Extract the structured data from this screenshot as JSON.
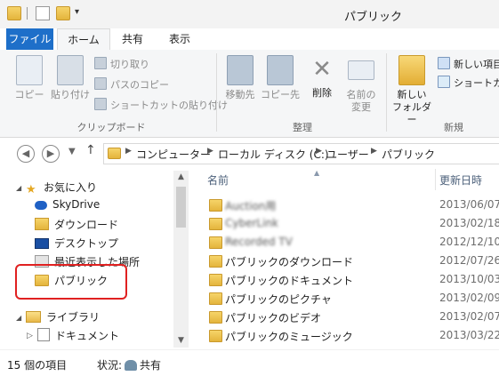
{
  "window": {
    "title": "パブリック"
  },
  "tabs": [
    {
      "label": "ファイル"
    },
    {
      "label": "ホーム"
    },
    {
      "label": "共有"
    },
    {
      "label": "表示"
    }
  ],
  "ribbon": {
    "clipboard": {
      "copy": "コピー",
      "paste": "貼り付け",
      "cut": "切り取り",
      "copy_path": "パスのコピー",
      "paste_shortcut": "ショートカットの貼り付け",
      "group_label": "クリップボード"
    },
    "organize": {
      "move_to": "移動先",
      "copy_to": "コピー先",
      "delete": "削除",
      "rename_line1": "名前の",
      "rename_line2": "変更",
      "group_label": "整理"
    },
    "new": {
      "new_folder_line1": "新しい",
      "new_folder_line2": "フォルダー",
      "new_item": "新しい項目",
      "shortcut": "ショートカット",
      "group_label": "新規"
    }
  },
  "address": {
    "breadcrumbs": [
      {
        "label": "コンピューター"
      },
      {
        "label": "ローカル ディスク (C:)"
      },
      {
        "label": "ユーザー"
      },
      {
        "label": "パブリック"
      }
    ]
  },
  "nav": {
    "favorites": "お気に入り",
    "skydrive": "SkyDrive",
    "downloads": "ダウンロード",
    "desktop": "デスクトップ",
    "recent": "最近表示した場所",
    "public": "パブリック",
    "libraries": "ライブラリ",
    "documents": "ドキュメント"
  },
  "content": {
    "columns": {
      "name": "名前",
      "date": "更新日時"
    },
    "files": [
      {
        "name": "Auction用",
        "date": "2013/06/07",
        "blurred": true
      },
      {
        "name": "CyberLink",
        "date": "2013/02/18",
        "blurred": true
      },
      {
        "name": "Recorded TV",
        "date": "2012/12/10",
        "blurred": true
      },
      {
        "name": "パブリックのダウンロード",
        "date": "2012/07/26",
        "blurred": false
      },
      {
        "name": "パブリックのドキュメント",
        "date": "2013/10/03",
        "blurred": false
      },
      {
        "name": "パブリックのピクチャ",
        "date": "2013/02/09",
        "blurred": false
      },
      {
        "name": "パブリックのビデオ",
        "date": "2013/02/07",
        "blurred": false
      },
      {
        "name": "パブリックのミュージック",
        "date": "2013/03/22",
        "blurred": false
      }
    ]
  },
  "status": {
    "item_count": "15 個の項目",
    "state_label": "状況:",
    "state_value": "共有"
  },
  "colors": {
    "file_tab": "#1e6fc9",
    "highlight": "#e02121",
    "folder": "#e4b43c"
  }
}
